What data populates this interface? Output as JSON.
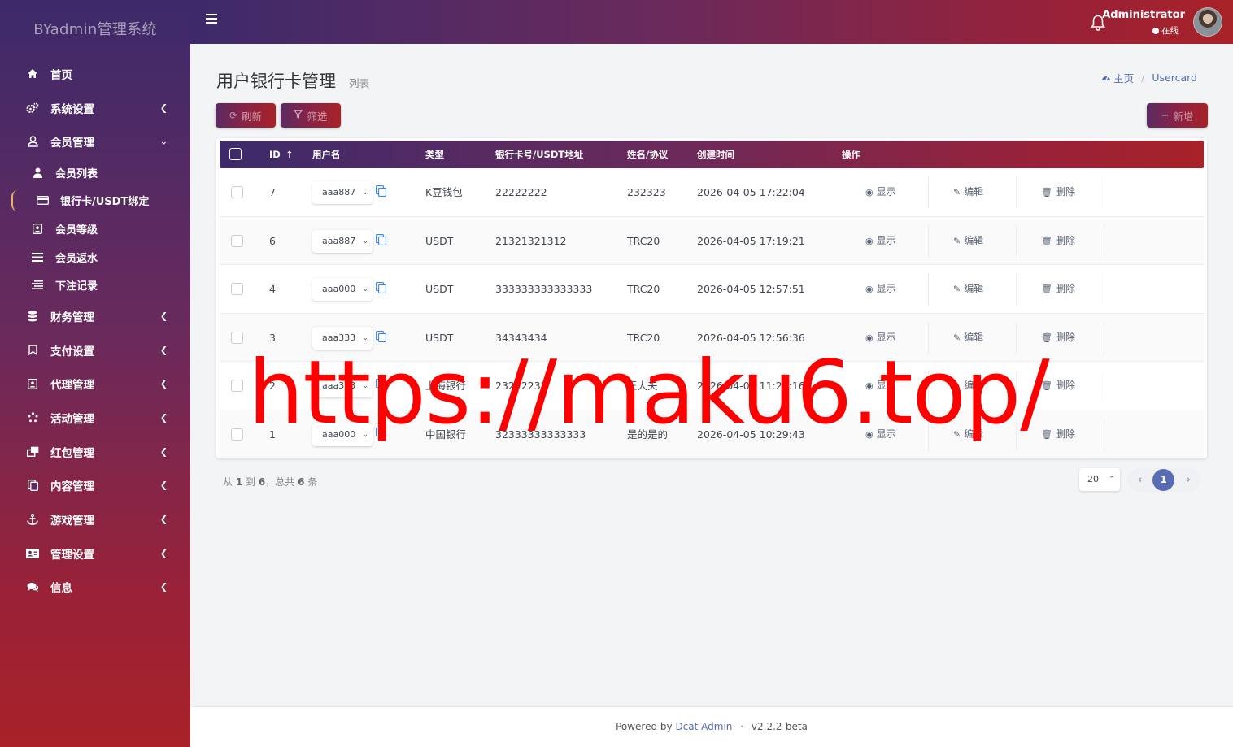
{
  "app": {
    "brand": "BYadmin管理系统"
  },
  "sidebar": {
    "items": [
      {
        "label": "首页",
        "icon": "home-icon"
      },
      {
        "label": "系统设置",
        "icon": "cogs-icon"
      },
      {
        "label": "会员管理",
        "icon": "user-icon"
      },
      {
        "label": "财务管理",
        "icon": "database-icon"
      },
      {
        "label": "支付设置",
        "icon": "bookmark-icon"
      },
      {
        "label": "代理管理",
        "icon": "id-badge-icon"
      },
      {
        "label": "活动管理",
        "icon": "spinner-icon"
      },
      {
        "label": "红包管理",
        "icon": "clone-icon"
      },
      {
        "label": "内容管理",
        "icon": "copy-icon"
      },
      {
        "label": "游戏管理",
        "icon": "anchor-icon"
      },
      {
        "label": "管理设置",
        "icon": "address-card-icon"
      },
      {
        "label": "信息",
        "icon": "comments-icon"
      }
    ],
    "sub_items": [
      {
        "label": "会员列表",
        "icon": "user-solid-icon"
      },
      {
        "label": "银行卡/USDT绑定",
        "icon": "credit-card-icon"
      },
      {
        "label": "会员等级",
        "icon": "id-badge-icon"
      },
      {
        "label": "会员返水",
        "icon": "list-icon"
      },
      {
        "label": "下注记录",
        "icon": "align-left-icon"
      }
    ]
  },
  "header": {
    "user_name": "Administrator",
    "user_status": "在线"
  },
  "page": {
    "title": "用户银行卡管理",
    "subtitle": "列表",
    "breadcrumb_home": "主页",
    "breadcrumb_current": "Usercard"
  },
  "toolbar": {
    "refresh_label": "刷新",
    "filter_label": "筛选",
    "new_label": "新增"
  },
  "table": {
    "columns": [
      "ID",
      "用户名",
      "类型",
      "银行卡号/USDT地址",
      "姓名/协议",
      "创建时间",
      "操作"
    ],
    "rows": [
      {
        "id": "7",
        "user": "aaa887",
        "type": "K豆钱包",
        "card": "22222222",
        "name": "232323",
        "created": "2026-04-05 17:22:04"
      },
      {
        "id": "6",
        "user": "aaa887",
        "type": "USDT",
        "card": "21321321312",
        "name": "TRC20",
        "created": "2026-04-05 17:19:21"
      },
      {
        "id": "4",
        "user": "aaa000",
        "type": "USDT",
        "card": "333333333333333",
        "name": "TRC20",
        "created": "2026-04-05 12:57:51"
      },
      {
        "id": "3",
        "user": "aaa333",
        "type": "USDT",
        "card": "34343434",
        "name": "TRC20",
        "created": "2026-04-05 12:56:36"
      },
      {
        "id": "2",
        "user": "aaa333",
        "type": "上海银行",
        "card": "23222232",
        "name": "王大夫",
        "created": "2026-04-05 11:22:16"
      },
      {
        "id": "1",
        "user": "aaa000",
        "type": "中国银行",
        "card": "32333333333333",
        "name": "是的是的",
        "created": "2026-04-05 10:29:43"
      }
    ],
    "actions": {
      "show": "显示",
      "edit": "编辑",
      "delete": "删除"
    }
  },
  "pagination": {
    "summary_prefix": "从",
    "from": "1",
    "to_word": "到",
    "to": "6",
    "total_word": "，总共",
    "total": "6",
    "unit": "条",
    "per_page": "20",
    "current_page": "1"
  },
  "footer": {
    "powered_by": "Powered by",
    "link": "Dcat Admin",
    "dot": "·",
    "version": "v2.2.2-beta"
  },
  "watermark": "https://maku6.top/"
}
